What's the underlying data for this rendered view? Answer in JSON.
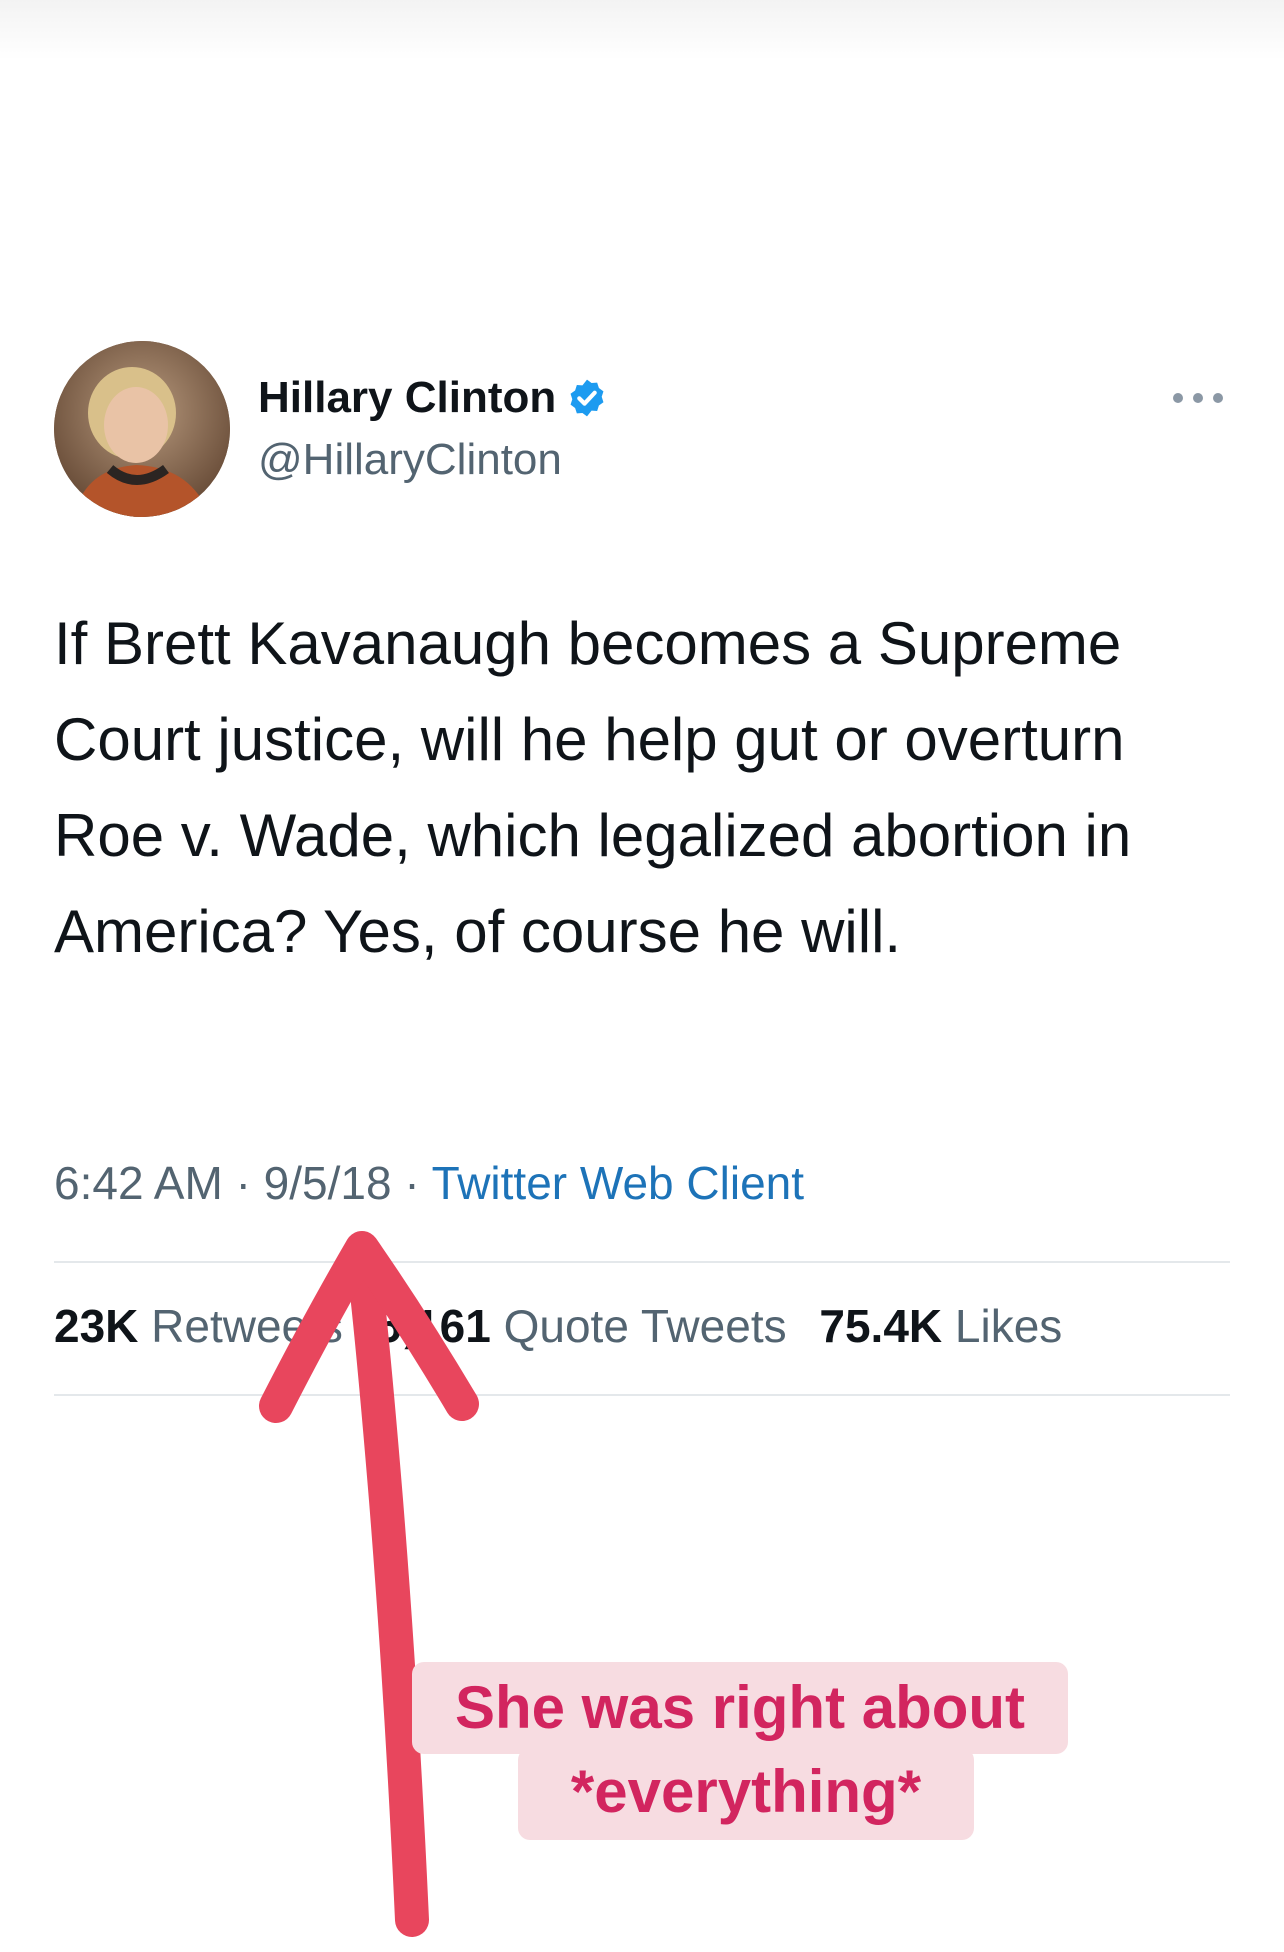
{
  "tweet": {
    "display_name": "Hillary Clinton",
    "handle": "@HillaryClinton",
    "text": "If Brett Kavanaugh becomes a Supreme Court justice, will he help gut or overturn Roe v. Wade, which legalized abortion in America? Yes, of course he will.",
    "time": "6:42 AM",
    "date": "9/5/18",
    "separator": "·",
    "source": "Twitter Web Client",
    "stats": {
      "retweets_count": "23K",
      "retweets_label": "Retweets",
      "quotes_count": "5,161",
      "quotes_label": "Quote Tweets",
      "likes_count": "75.4K",
      "likes_label": "Likes"
    }
  },
  "annotation": {
    "caption_line1": "She was right about",
    "caption_line2": "*everything*",
    "arrow_color": "#e8465d",
    "caption_color": "#d2255f",
    "caption_bg": "#f7dce1"
  },
  "colors": {
    "text_primary": "#0f1419",
    "text_secondary": "#536471",
    "link": "#1d73b8",
    "verified": "#1d9bf0"
  },
  "icons": {
    "verified": "verified-badge-icon",
    "more": "more-dots-icon"
  }
}
